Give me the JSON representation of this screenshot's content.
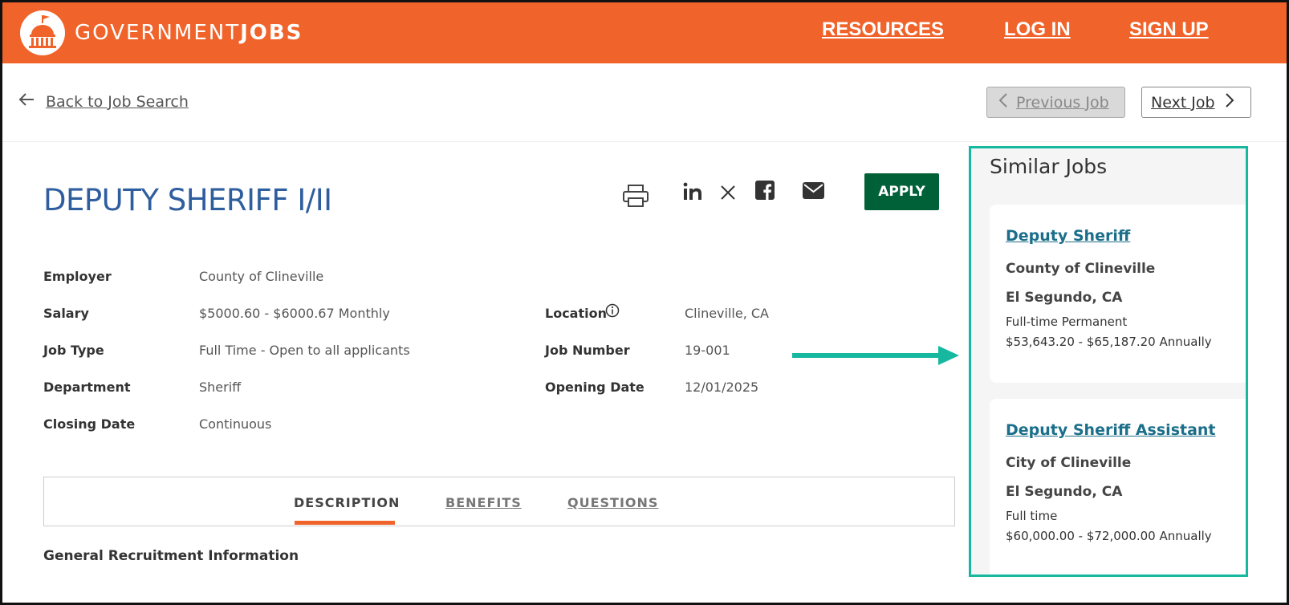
{
  "header": {
    "logo_text_light": "GOVERNMENT",
    "logo_text_bold": "JOBS",
    "nav": [
      "RESOURCES",
      "LOG IN",
      "SIGN UP"
    ],
    "brand_color": "#f0632a"
  },
  "subnav": {
    "back_label": "Back to Job Search",
    "prev_label": "Previous Job",
    "next_label": "Next Job"
  },
  "job": {
    "title": "DEPUTY SHERIFF I/II",
    "apply_label": "APPLY",
    "fields_left": [
      {
        "label": "Employer",
        "value": "County of Clineville"
      },
      {
        "label": "Salary",
        "value": "$5000.60 - $6000.67 Monthly"
      },
      {
        "label": "Job Type",
        "value": "Full Time - Open to all applicants"
      },
      {
        "label": "Department",
        "value": "Sheriff"
      },
      {
        "label": "Closing Date",
        "value": "Continuous"
      }
    ],
    "fields_right": [
      {
        "label": "Location",
        "value": "Clineville, CA"
      },
      {
        "label": "Job Number",
        "value": "19-001"
      },
      {
        "label": "Opening Date",
        "value": "12/01/2025"
      }
    ],
    "share_icons": [
      "print-icon",
      "linkedin-icon",
      "x-icon",
      "facebook-icon",
      "email-icon"
    ]
  },
  "tabs": [
    "DESCRIPTION",
    "BENEFITS",
    "QUESTIONS"
  ],
  "section_heading": "General Recruitment Information",
  "similar": {
    "heading": "Similar Jobs",
    "jobs": [
      {
        "title": "Deputy Sheriff",
        "employer": "County of Clineville",
        "location": "El Segundo, CA",
        "type": "Full-time Permanent",
        "salary": "$53,643.20 - $65,187.20 Annually"
      },
      {
        "title": "Deputy Sheriff Assistant",
        "employer": "City of Clineville",
        "location": "El Segundo, CA",
        "type": "Full time",
        "salary": "$60,000.00 - $72,000.00 Annually"
      }
    ]
  },
  "colors": {
    "accent_teal": "#17b8a0",
    "apply_green": "#006138",
    "title_blue": "#2f5e9e"
  }
}
